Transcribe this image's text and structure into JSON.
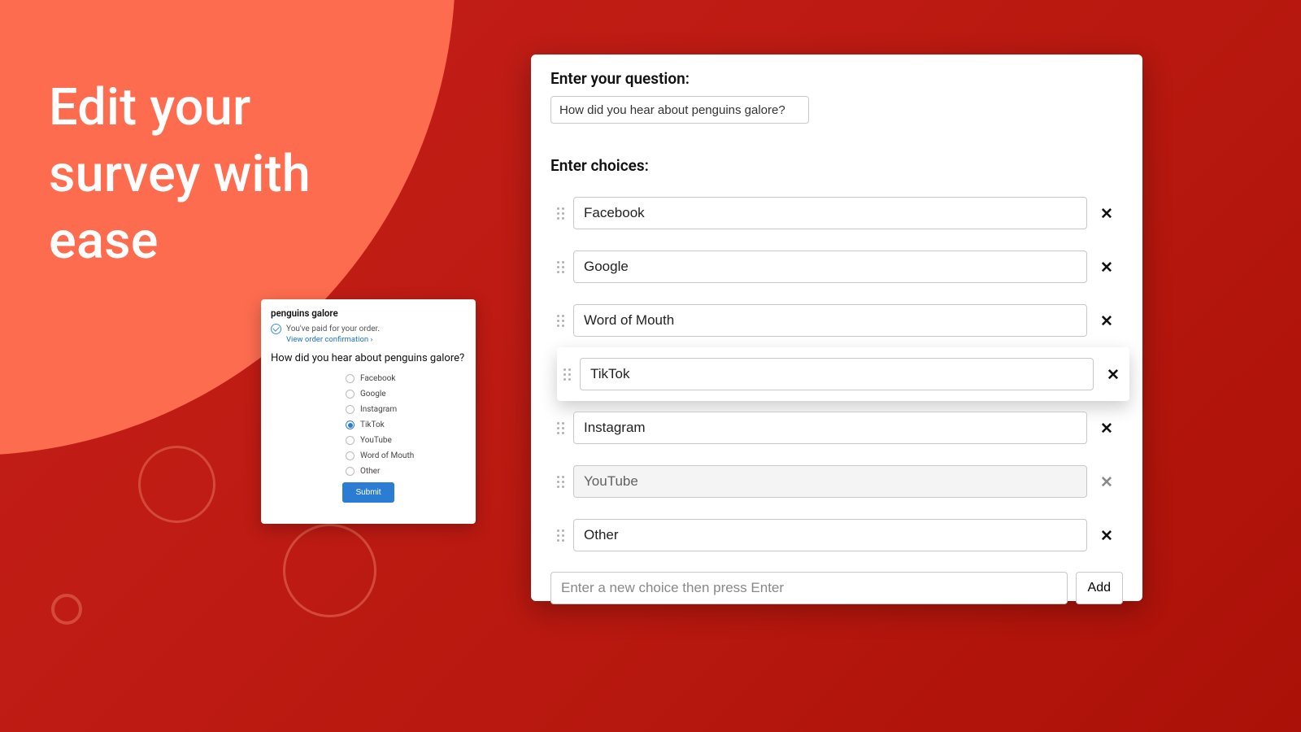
{
  "headline": "Edit your\nsurvey with\nease",
  "preview": {
    "brand": "penguins galore",
    "paid_text": "You've paid for your order.",
    "confirmation_link": "View order confirmation ›",
    "question": "How did you hear about penguins galore?",
    "options": [
      {
        "label": "Facebook",
        "selected": false
      },
      {
        "label": "Google",
        "selected": false
      },
      {
        "label": "Instagram",
        "selected": false
      },
      {
        "label": "TikTok",
        "selected": true
      },
      {
        "label": "YouTube",
        "selected": false
      },
      {
        "label": "Word of Mouth",
        "selected": false
      },
      {
        "label": "Other",
        "selected": false
      }
    ],
    "submit_label": "Submit"
  },
  "editor": {
    "question_label": "Enter your question:",
    "question_value": "How did you hear about penguins galore?",
    "choices_label": "Enter choices:",
    "choices": [
      {
        "value": "Facebook",
        "state": "normal"
      },
      {
        "value": "Google",
        "state": "normal"
      },
      {
        "value": "Word of Mouth",
        "state": "normal"
      },
      {
        "value": "TikTok",
        "state": "elevated"
      },
      {
        "value": "Instagram",
        "state": "normal"
      },
      {
        "value": "YouTube",
        "state": "faded"
      },
      {
        "value": "Other",
        "state": "normal"
      }
    ],
    "new_choice_placeholder": "Enter a new choice then press Enter",
    "add_label": "Add"
  }
}
